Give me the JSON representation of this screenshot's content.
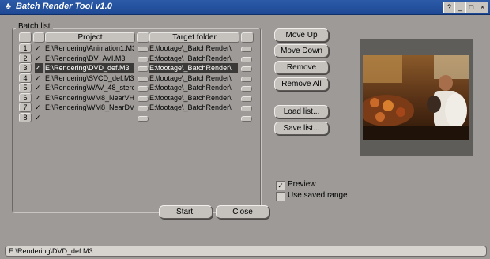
{
  "window": {
    "title": "Batch Render Tool v1.0",
    "icon": "app-icon",
    "controls": [
      "?",
      "_",
      "□",
      "×"
    ]
  },
  "batch": {
    "group_label": "Batch list",
    "col_project": "Project",
    "col_target": "Target folder",
    "rows": [
      {
        "num": "1",
        "checked": true,
        "project": "E:\\Rendering\\Animation1.M3",
        "target": "E:\\footage\\_BatchRender\\"
      },
      {
        "num": "2",
        "checked": true,
        "project": "E:\\Rendering\\DV_AVI.M3",
        "target": "E:\\footage\\_BatchRender\\"
      },
      {
        "num": "3",
        "checked": true,
        "project": "E:\\Rendering\\DVD_def.M3",
        "target": "E:\\footage\\_BatchRender\\",
        "selected": true
      },
      {
        "num": "4",
        "checked": true,
        "project": "E:\\Rendering\\SVCD_def.M3",
        "target": "E:\\footage\\_BatchRender\\"
      },
      {
        "num": "5",
        "checked": true,
        "project": "E:\\Rendering\\WAV_48_stere",
        "target": "E:\\footage\\_BatchRender\\"
      },
      {
        "num": "6",
        "checked": true,
        "project": "E:\\Rendering\\WM8_NearVHS",
        "target": "E:\\footage\\_BatchRender\\"
      },
      {
        "num": "7",
        "checked": true,
        "project": "E:\\Rendering\\WM8_NearDVD",
        "target": "E:\\footage\\_BatchRender\\"
      },
      {
        "num": "8",
        "checked": true,
        "project": "",
        "target": ""
      }
    ]
  },
  "buttons": {
    "move_up": "Move Up",
    "move_down": "Move Down",
    "remove": "Remove",
    "remove_all": "Remove All",
    "load_list": "Load list...",
    "save_list": "Save list...",
    "start": "Start!",
    "close": "Close"
  },
  "options": {
    "preview_label": "Preview",
    "preview_checked": true,
    "use_saved_range_label": "Use saved range",
    "use_saved_range_checked": false
  },
  "status": {
    "text": "E:\\Rendering\\DVD_def.M3"
  },
  "colors": {
    "title_bar": "#1e4894",
    "window_bg": "#9d9a97",
    "selected_row": "#3b3937"
  }
}
